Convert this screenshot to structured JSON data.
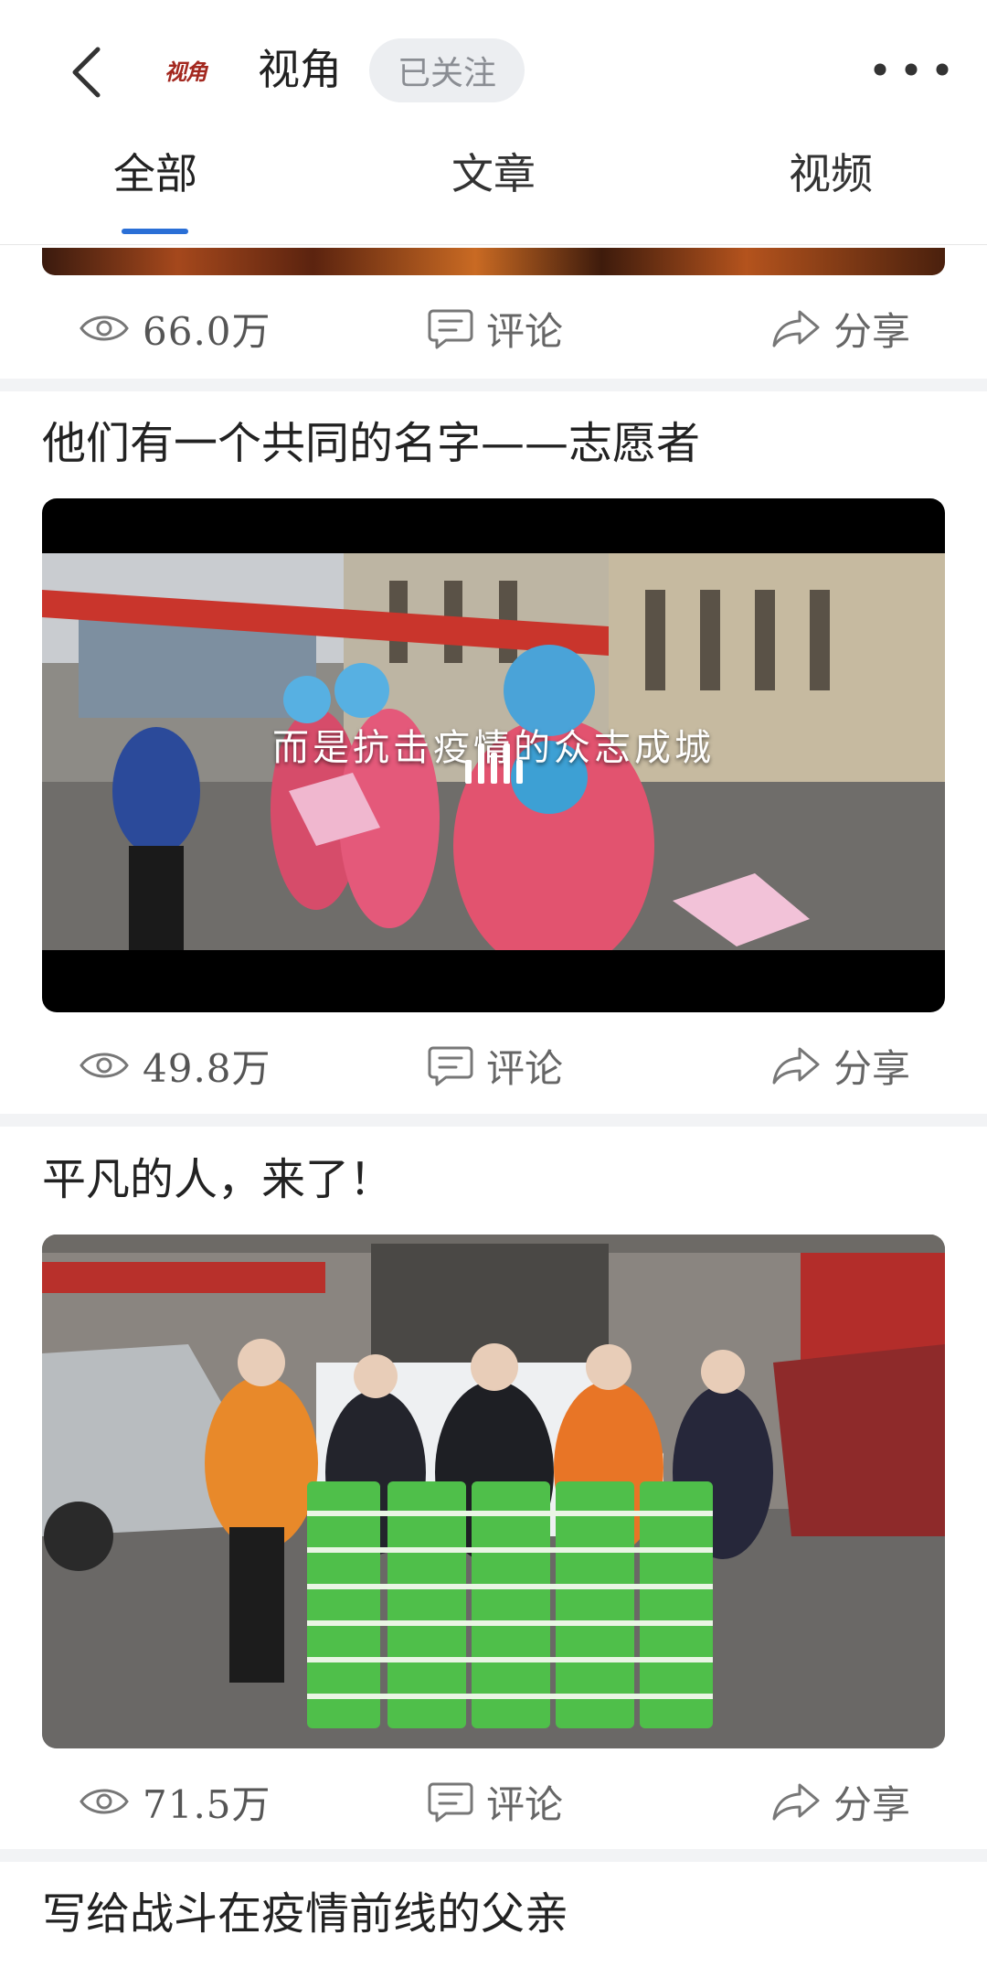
{
  "header": {
    "back_icon": "chevron-left-icon",
    "logo_text": "视角",
    "channel_name": "视角",
    "follow_label": "已关注",
    "more_icon": "more-dots-icon"
  },
  "tabs": [
    {
      "label": "全部",
      "active": true
    },
    {
      "label": "文章",
      "active": false
    },
    {
      "label": "视频",
      "active": false
    }
  ],
  "feed": [
    {
      "views": "66.0万",
      "comment_label": "评论",
      "share_label": "分享"
    },
    {
      "title": "他们有一个共同的名字——志愿者",
      "media_type": "video",
      "caption": "而是抗击疫情的众志成城",
      "views": "49.8万",
      "comment_label": "评论",
      "share_label": "分享"
    },
    {
      "title": "平凡的人，来了！",
      "media_type": "image",
      "views": "71.5万",
      "comment_label": "评论",
      "share_label": "分享"
    },
    {
      "title": "写给战斗在疫情前线的父亲"
    }
  ],
  "colors": {
    "accent": "#2a6fd6",
    "follow_bg": "#eceef1",
    "separator": "#f2f3f5",
    "icon_gray": "#8a8d93"
  }
}
